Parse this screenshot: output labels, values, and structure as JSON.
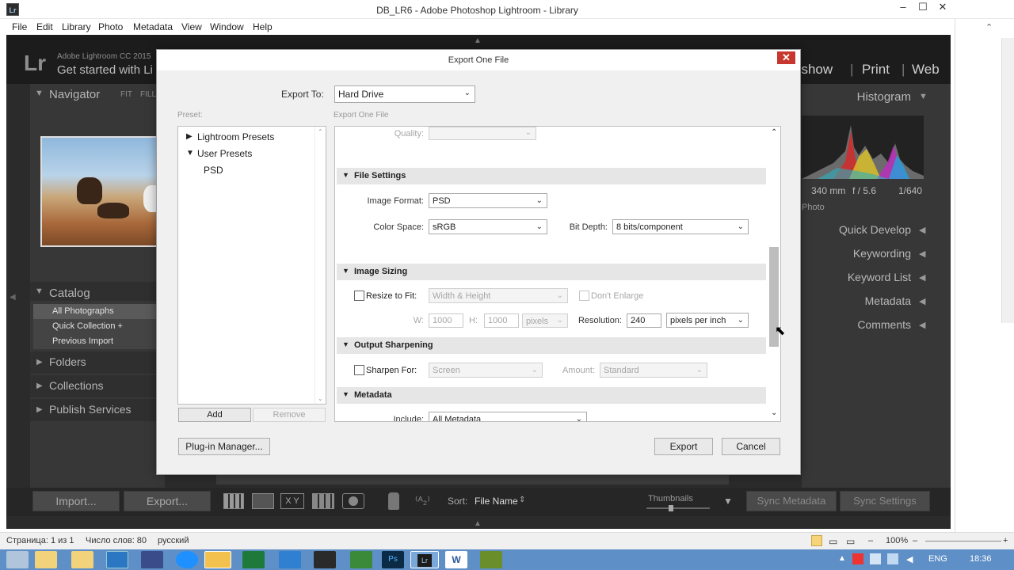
{
  "window": {
    "title": "DB_LR6 - Adobe Photoshop Lightroom - Library",
    "app_icon": "Lr"
  },
  "menu": [
    "File",
    "Edit",
    "Library",
    "Photo",
    "Metadata",
    "View",
    "Window",
    "Help"
  ],
  "lightroom": {
    "logo": "Lr",
    "sub1": "Adobe Lightroom CC 2015",
    "sub2": "Get started with Li",
    "modules": [
      "eshow",
      "Print",
      "Web"
    ],
    "navigator": {
      "title": "Navigator",
      "fit": "FIT",
      "fill": "FILL"
    },
    "catalog": {
      "title": "Catalog",
      "items": [
        "All Photographs",
        "Quick Collection  +",
        "Previous Import"
      ]
    },
    "left_sections": [
      "Folders",
      "Collections",
      "Publish Services"
    ],
    "right": {
      "histogram": "Histogram",
      "info1": "340 mm",
      "info2": "f / 5.6",
      "info3": "1/640",
      "info4": "Photo",
      "panels": [
        "Quick Develop",
        "Keywording",
        "Keyword List",
        "Metadata",
        "Comments"
      ]
    },
    "bottom": {
      "import": "Import...",
      "export": "Export...",
      "sort_label": "Sort:",
      "sort_value": "File Name",
      "thumbnails": "Thumbnails",
      "sync_metadata": "Sync Metadata",
      "sync_settings": "Sync Settings"
    }
  },
  "dialog": {
    "title": "Export One File",
    "close": "✕",
    "export_to_label": "Export To:",
    "export_to_value": "Hard Drive",
    "preset_label": "Preset:",
    "settings_label": "Export One File",
    "presets": {
      "lightroom": "Lightroom Presets",
      "user": "User Presets",
      "psd": "PSD"
    },
    "add": "Add",
    "remove": "Remove",
    "quality_label": "Quality:",
    "file_settings": {
      "header": "File Settings",
      "image_format_label": "Image Format:",
      "image_format": "PSD",
      "color_space_label": "Color Space:",
      "color_space": "sRGB",
      "bit_depth_label": "Bit Depth:",
      "bit_depth": "8 bits/component"
    },
    "image_sizing": {
      "header": "Image Sizing",
      "resize_label": "Resize to Fit:",
      "resize_mode": "Width & Height",
      "dont_enlarge": "Don't Enlarge",
      "w_label": "W:",
      "w_value": "1000",
      "h_label": "H:",
      "h_value": "1000",
      "unit": "pixels",
      "resolution_label": "Resolution:",
      "resolution": "240",
      "resolution_unit": "pixels per inch"
    },
    "output_sharpening": {
      "header": "Output Sharpening",
      "sharpen_label": "Sharpen For:",
      "sharpen_for": "Screen",
      "amount_label": "Amount:",
      "amount": "Standard"
    },
    "metadata": {
      "header": "Metadata",
      "include_label": "Include:",
      "include": "All Metadata"
    },
    "plugin_manager": "Plug-in Manager...",
    "export": "Export",
    "cancel": "Cancel"
  },
  "status": {
    "page": "Страница: 1 из 1",
    "words": "Число слов: 80",
    "lang": "русский",
    "zoom": "100%"
  },
  "taskbar": {
    "lang": "ENG",
    "time": "18:36"
  }
}
